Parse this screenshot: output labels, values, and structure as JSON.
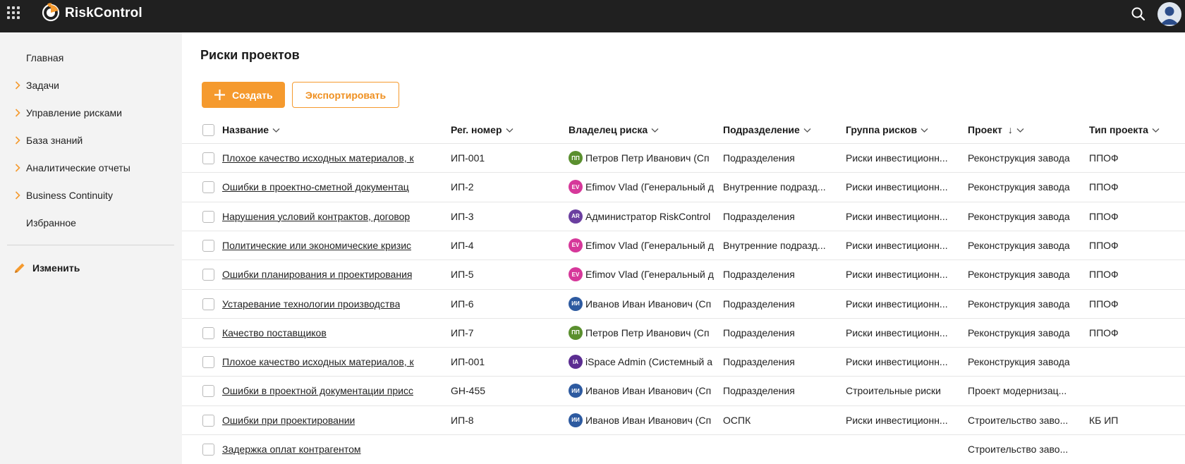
{
  "app": {
    "brand": "RiskControl",
    "icons": {
      "apps": "apps-grid-icon",
      "logo": "riskcontrol-logo",
      "search": "search-icon",
      "user": "user-avatar-icon"
    }
  },
  "sidebar": {
    "items": [
      {
        "label": "Главная",
        "expandable": false
      },
      {
        "label": "Задачи",
        "expandable": true
      },
      {
        "label": "Управление рисками",
        "expandable": true
      },
      {
        "label": "База знаний",
        "expandable": true
      },
      {
        "label": "Аналитические отчеты",
        "expandable": true
      },
      {
        "label": "Business Continuity",
        "expandable": true
      },
      {
        "label": "Избранное",
        "expandable": false
      }
    ],
    "edit_label": "Изменить"
  },
  "page": {
    "title": "Риски проектов",
    "create_label": "Создать",
    "export_label": "Экспортировать"
  },
  "colors": {
    "accent": "#f59a2e",
    "topbar": "#202020",
    "sidebar": "#f3f3f3"
  },
  "table": {
    "columns": [
      "Название",
      "Рег. номер",
      "Владелец риска",
      "Подразделение",
      "Группа рисков",
      "Проект",
      "Тип проекта"
    ],
    "sort": {
      "column": "Проект",
      "direction": "↓"
    },
    "rows": [
      {
        "name": "Плохое качество исходных материалов, к",
        "reg": "ИП-001",
        "owner_initials": "ПП",
        "owner_color": "#5a8f2e",
        "owner": "Петров Петр Иванович (Сп",
        "dept": "Подразделения",
        "group": "Риски инвестиционн...",
        "project": "Реконструкция завода",
        "ptype": "ППОФ"
      },
      {
        "name": "Ошибки в проектно-сметной документац",
        "reg": "ИП-2",
        "owner_initials": "EV",
        "owner_color": "#d6389a",
        "owner": "Efimov Vlad (Генеральный д",
        "dept": "Внутренние подразд...",
        "group": "Риски инвестиционн...",
        "project": "Реконструкция завода",
        "ptype": "ППОФ"
      },
      {
        "name": "Нарушения условий контрактов, договор",
        "reg": "ИП-3",
        "owner_initials": "АR",
        "owner_color": "#6b3fa0",
        "owner": "Администратор RiskControl",
        "dept": "Подразделения",
        "group": "Риски инвестиционн...",
        "project": "Реконструкция завода",
        "ptype": "ППОФ"
      },
      {
        "name": "Политические или экономические кризис",
        "reg": "ИП-4",
        "owner_initials": "EV",
        "owner_color": "#d6389a",
        "owner": "Efimov Vlad (Генеральный д",
        "dept": "Внутренние подразд...",
        "group": "Риски инвестиционн...",
        "project": "Реконструкция завода",
        "ptype": "ППОФ"
      },
      {
        "name": "Ошибки планирования и проектирования",
        "reg": "ИП-5",
        "owner_initials": "EV",
        "owner_color": "#d6389a",
        "owner": "Efimov Vlad (Генеральный д",
        "dept": "Подразделения",
        "group": "Риски инвестиционн...",
        "project": "Реконструкция завода",
        "ptype": "ППОФ"
      },
      {
        "name": "Устаревание технологии производства",
        "reg": "ИП-6",
        "owner_initials": "ИИ",
        "owner_color": "#2d5aa0",
        "owner": "Иванов Иван Иванович (Сп",
        "dept": "Подразделения",
        "group": "Риски инвестиционн...",
        "project": "Реконструкция завода",
        "ptype": "ППОФ"
      },
      {
        "name": "Качество поставщиков",
        "reg": "ИП-7",
        "owner_initials": "ПП",
        "owner_color": "#5a8f2e",
        "owner": "Петров Петр Иванович (Сп",
        "dept": "Подразделения",
        "group": "Риски инвестиционн...",
        "project": "Реконструкция завода",
        "ptype": "ППОФ"
      },
      {
        "name": "Плохое качество исходных материалов, к",
        "reg": "ИП-001",
        "owner_initials": "IA",
        "owner_color": "#5b2d91",
        "owner": "iSpace Admin (Системный а",
        "dept": "Подразделения",
        "group": "Риски инвестиционн...",
        "project": "Реконструкция завода",
        "ptype": ""
      },
      {
        "name": "Ошибки в проектной документации присс",
        "reg": "GH-455",
        "owner_initials": "ИИ",
        "owner_color": "#2d5aa0",
        "owner": "Иванов Иван Иванович (Сп",
        "dept": "Подразделения",
        "group": "Строительные риски",
        "project": "Проект модернизац...",
        "ptype": ""
      },
      {
        "name": "Ошибки при проектировании",
        "reg": "ИП-8",
        "owner_initials": "ИИ",
        "owner_color": "#2d5aa0",
        "owner": "Иванов Иван Иванович (Сп",
        "dept": "ОСПК",
        "group": "Риски инвестиционн...",
        "project": "Строительство заво...",
        "ptype": "КБ ИП"
      },
      {
        "name": "Задержка оплат контрагентом",
        "reg": "",
        "owner_initials": "",
        "owner_color": "",
        "owner": "",
        "dept": "",
        "group": "",
        "project": "Строительство заво...",
        "ptype": ""
      }
    ]
  }
}
